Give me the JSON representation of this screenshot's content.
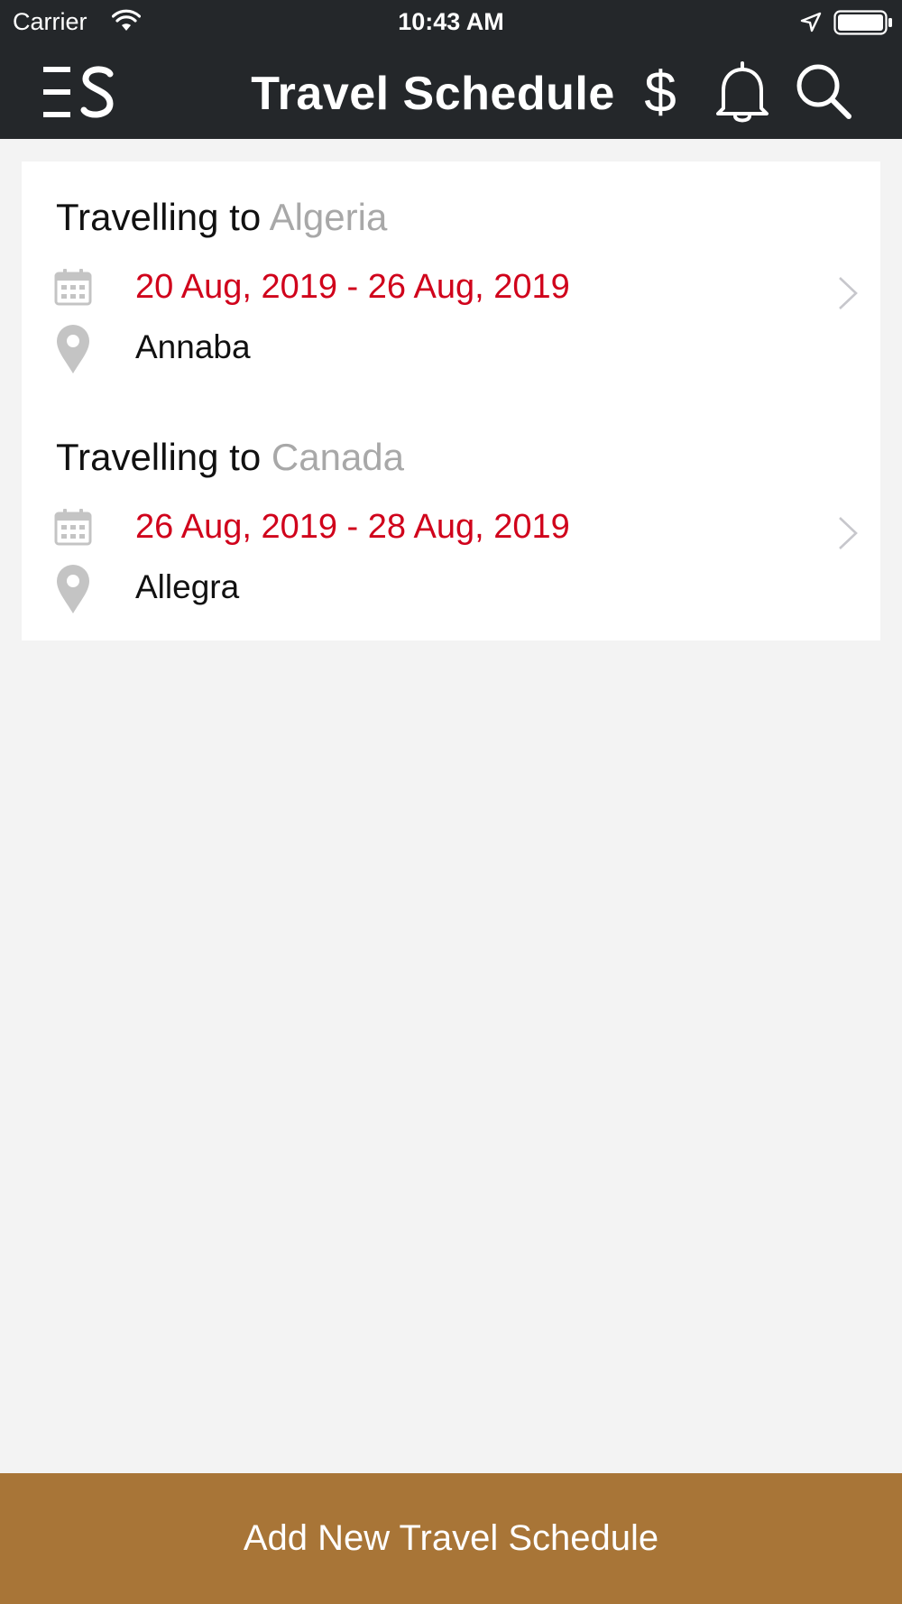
{
  "status_bar": {
    "carrier": "Carrier",
    "time": "10:43 AM"
  },
  "nav": {
    "title": "Travel Schedule",
    "currency_symbol": "$"
  },
  "trips": [
    {
      "prefix": "Travelling to",
      "country": "Algeria",
      "dates": "20 Aug, 2019 - 26 Aug, 2019",
      "city": "Annaba"
    },
    {
      "prefix": "Travelling to",
      "country": "Canada",
      "dates": "26 Aug, 2019 - 28 Aug, 2019",
      "city": "Allegra"
    }
  ],
  "footer": {
    "add_label": "Add New Travel Schedule"
  },
  "colors": {
    "header_bg": "#24272a",
    "accent_red": "#d0021b",
    "button_brown": "#a87537",
    "country_gray": "#a8a8a8"
  },
  "icons": [
    "wifi-icon",
    "location-arrow-icon",
    "battery-icon",
    "menu-icon",
    "dollar-icon",
    "bell-icon",
    "search-icon",
    "calendar-icon",
    "map-pin-icon",
    "chevron-right-icon"
  ]
}
